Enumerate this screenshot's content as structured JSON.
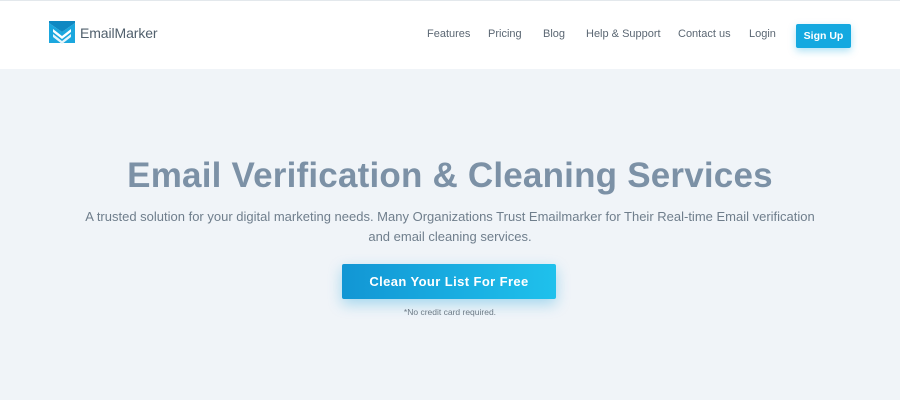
{
  "brand": {
    "name": "EmailMarker",
    "logo_icon": "envelope-logo-icon",
    "accent": "#14a9e0"
  },
  "nav": {
    "items": [
      {
        "label": "Features"
      },
      {
        "label": "Pricing"
      },
      {
        "label": "Blog"
      },
      {
        "label": "Help & Support"
      },
      {
        "label": "Contact us"
      },
      {
        "label": "Login"
      }
    ],
    "signup_label": "Sign Up"
  },
  "hero": {
    "title": "Email Verification & Cleaning Services",
    "subtitle_line1": "A trusted solution for your digital marketing needs. Many Organizations Trust Emailmarker for Their Real-time Email verification",
    "subtitle_line2": "and email cleaning services.",
    "cta_label": "Clean Your List For Free",
    "note": "*No credit card required."
  }
}
